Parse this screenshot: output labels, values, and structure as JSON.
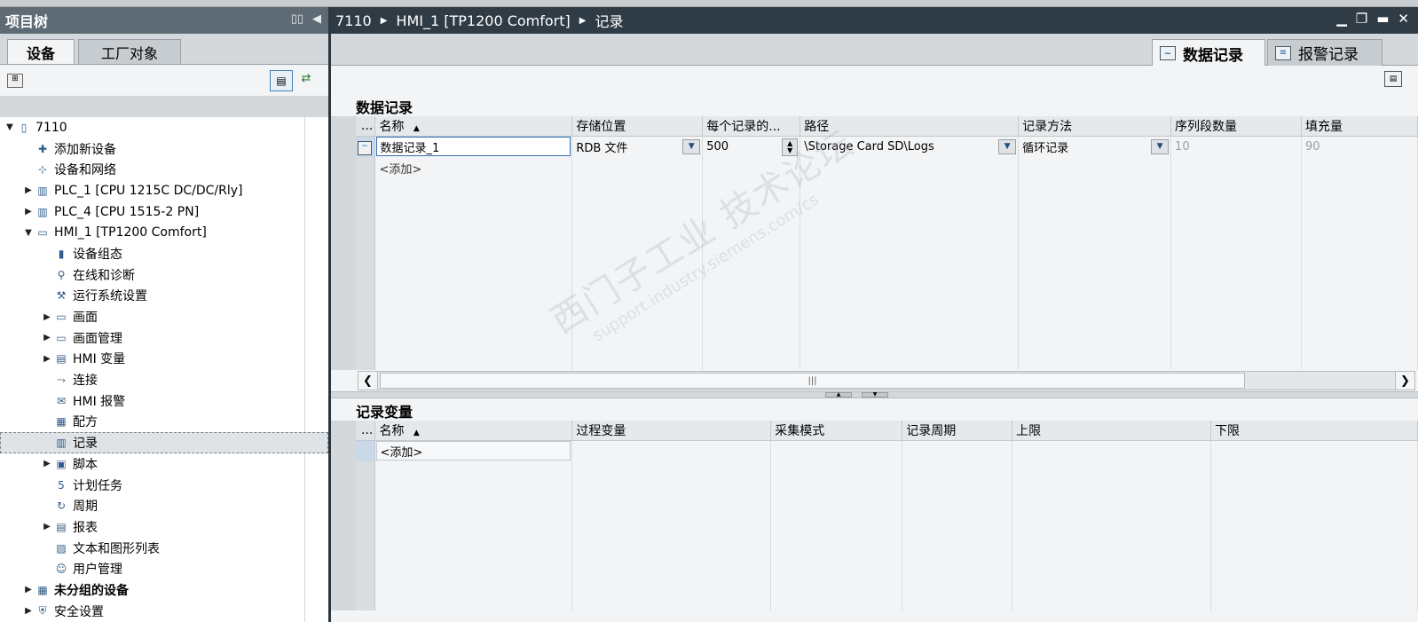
{
  "project_tree": {
    "title": "项目树",
    "tabs": [
      "设备",
      "工厂对象"
    ],
    "items": [
      {
        "label": "7110",
        "level": 0,
        "arrow": "down",
        "icon": "project-icon"
      },
      {
        "label": "添加新设备",
        "level": 1,
        "arrow": "",
        "icon": "add-device-icon"
      },
      {
        "label": "设备和网络",
        "level": 1,
        "arrow": "",
        "icon": "network-icon"
      },
      {
        "label": "PLC_1 [CPU 1215C DC/DC/Rly]",
        "level": 1,
        "arrow": "right",
        "icon": "plc-icon"
      },
      {
        "label": "PLC_4 [CPU 1515-2 PN]",
        "level": 1,
        "arrow": "right",
        "icon": "plc-icon"
      },
      {
        "label": "HMI_1 [TP1200 Comfort]",
        "level": 1,
        "arrow": "down",
        "icon": "hmi-icon"
      },
      {
        "label": "设备组态",
        "level": 2,
        "arrow": "",
        "icon": "device-config-icon"
      },
      {
        "label": "在线和诊断",
        "level": 2,
        "arrow": "",
        "icon": "diagnostics-icon"
      },
      {
        "label": "运行系统设置",
        "level": 2,
        "arrow": "",
        "icon": "runtime-settings-icon"
      },
      {
        "label": "画面",
        "level": 2,
        "arrow": "right",
        "icon": "folder-icon"
      },
      {
        "label": "画面管理",
        "level": 2,
        "arrow": "right",
        "icon": "folder-icon"
      },
      {
        "label": "HMI 变量",
        "level": 2,
        "arrow": "right",
        "icon": "tag-folder-icon"
      },
      {
        "label": "连接",
        "level": 2,
        "arrow": "",
        "icon": "connection-icon"
      },
      {
        "label": "HMI 报警",
        "level": 2,
        "arrow": "",
        "icon": "alarm-icon"
      },
      {
        "label": "配方",
        "level": 2,
        "arrow": "",
        "icon": "recipe-icon"
      },
      {
        "label": "记录",
        "level": 2,
        "arrow": "",
        "icon": "log-icon",
        "selected": true
      },
      {
        "label": "脚本",
        "level": 2,
        "arrow": "right",
        "icon": "script-icon"
      },
      {
        "label": "计划任务",
        "level": 2,
        "arrow": "",
        "icon": "scheduler-icon"
      },
      {
        "label": "周期",
        "level": 2,
        "arrow": "",
        "icon": "cycle-icon"
      },
      {
        "label": "报表",
        "level": 2,
        "arrow": "right",
        "icon": "report-icon"
      },
      {
        "label": "文本和图形列表",
        "level": 2,
        "arrow": "",
        "icon": "text-graphic-list-icon"
      },
      {
        "label": "用户管理",
        "level": 2,
        "arrow": "",
        "icon": "user-admin-icon"
      },
      {
        "label": "未分组的设备",
        "level": 1,
        "arrow": "right",
        "icon": "ungrouped-devices-icon",
        "bold": true
      },
      {
        "label": "安全设置",
        "level": 1,
        "arrow": "right",
        "icon": "security-icon"
      }
    ]
  },
  "breadcrumb": [
    "7110",
    "HMI_1 [TP1200 Comfort]",
    "记录"
  ],
  "editor_tabs": [
    "数据记录",
    "报警记录"
  ],
  "data_logs": {
    "title": "数据记录",
    "row_header": "...",
    "columns": [
      "名称",
      "存储位置",
      "每个记录的...",
      "路径",
      "记录方法",
      "序列段数量",
      "填充量"
    ],
    "rows": [
      {
        "name": "数据记录_1",
        "storage": "RDB 文件",
        "records": "500",
        "path": "\\Storage Card SD\\Logs",
        "method": "循环记录",
        "segments": "10",
        "fill": "90"
      }
    ],
    "add_label": "<添加>"
  },
  "log_tags": {
    "title": "记录变量",
    "row_header": "...",
    "columns": [
      "名称",
      "过程变量",
      "采集模式",
      "记录周期",
      "上限",
      "下限"
    ],
    "add_label": "<添加>"
  },
  "watermark": {
    "line1": "西门子工业  技术论坛",
    "line2": "support.industry.siemens.com/cs"
  },
  "colors": {
    "header_dark": "#2f3c46",
    "tree_header": "#5e6b74",
    "selection_blue": "#2f6fb5"
  }
}
